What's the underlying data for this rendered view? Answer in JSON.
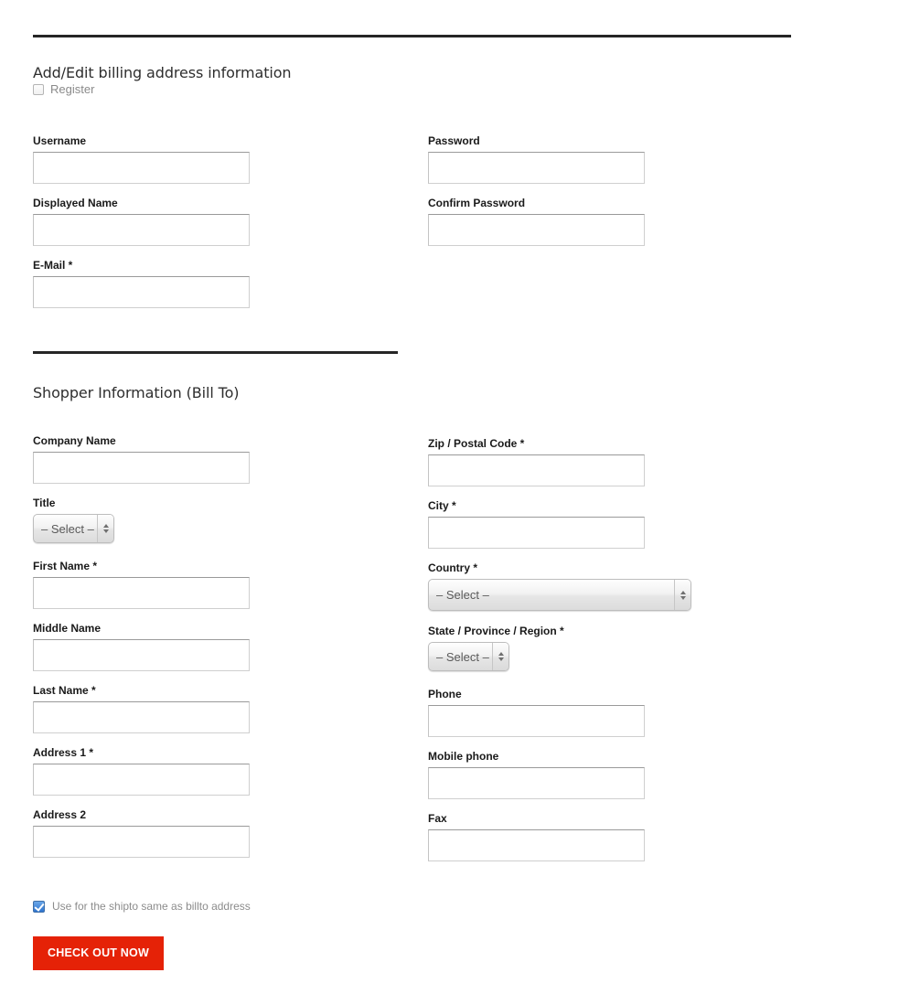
{
  "colors": {
    "rule": "#262626",
    "checkout_button_bg": "#e52207",
    "checkout_button_text": "#ffffff",
    "label_text": "#1a1a1a",
    "muted_text": "#8a8a8a",
    "input_border": "#cfcfcf",
    "checkbox_checked": "#2e74cf"
  },
  "billing_section": {
    "heading": "Add/Edit billing address information",
    "register": {
      "label": "Register",
      "checked": false
    },
    "fields_left": [
      {
        "label": "Username",
        "value": "",
        "placeholder": ""
      },
      {
        "label": "Displayed Name",
        "value": "",
        "placeholder": ""
      },
      {
        "label": "E-Mail *",
        "value": "",
        "placeholder": ""
      }
    ],
    "fields_right": [
      {
        "label": "Password",
        "value": "",
        "placeholder": ""
      },
      {
        "label": "Confirm Password",
        "value": "",
        "placeholder": ""
      }
    ]
  },
  "shopper_section": {
    "heading": "Shopper Information (Bill To)",
    "fields_left": [
      {
        "label": "Company Name",
        "value": "",
        "placeholder": ""
      },
      {
        "label": "First Name *",
        "value": "",
        "placeholder": ""
      },
      {
        "label": "Middle Name",
        "value": "",
        "placeholder": ""
      },
      {
        "label": "Last Name *",
        "value": "",
        "placeholder": ""
      },
      {
        "label": "Address 1 *",
        "value": "",
        "placeholder": ""
      },
      {
        "label": "Address 2",
        "value": "",
        "placeholder": ""
      }
    ],
    "title_select": {
      "label": "Title",
      "selected": "– Select –",
      "options": [
        "– Select –"
      ]
    },
    "fields_right": [
      {
        "label": "Zip / Postal Code *",
        "value": "",
        "placeholder": ""
      },
      {
        "label": "City *",
        "value": "",
        "placeholder": ""
      },
      {
        "label": "Phone",
        "value": "",
        "placeholder": ""
      },
      {
        "label": "Mobile phone",
        "value": "",
        "placeholder": ""
      },
      {
        "label": "Fax",
        "value": "",
        "placeholder": ""
      }
    ],
    "country_select": {
      "label": "Country *",
      "selected": "– Select –",
      "options": [
        "– Select –"
      ]
    },
    "state_select": {
      "label": "State / Province / Region *",
      "selected": "– Select –",
      "options": [
        "– Select –"
      ]
    }
  },
  "footer": {
    "shipto_checkbox": {
      "label": "Use for the shipto same as billto address",
      "checked": true
    },
    "checkout_button": "CHECK OUT NOW"
  },
  "icons": {
    "select_arrows": "up-down-arrows-icon",
    "checkmark": "checkmark-icon"
  }
}
